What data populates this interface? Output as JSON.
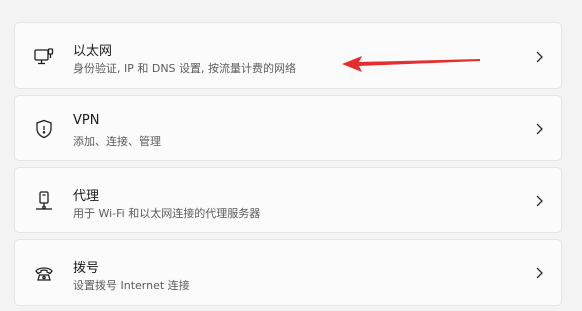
{
  "items": [
    {
      "title": "以太网",
      "subtitle": "身份验证, IP 和 DNS 设置, 按流量计费的网络",
      "icon": "ethernet-icon"
    },
    {
      "title": "VPN",
      "subtitle": "添加、连接、管理",
      "icon": "vpn-shield-icon"
    },
    {
      "title": "代理",
      "subtitle": "用于 Wi-Fi 和以太网连接的代理服务器",
      "icon": "proxy-icon"
    },
    {
      "title": "拨号",
      "subtitle": "设置拨号 Internet 连接",
      "icon": "dial-up-icon"
    }
  ],
  "colors": {
    "background": "#f3f3f3",
    "card": "#fbfbfb",
    "annotation_arrow": "#e62e2e"
  }
}
